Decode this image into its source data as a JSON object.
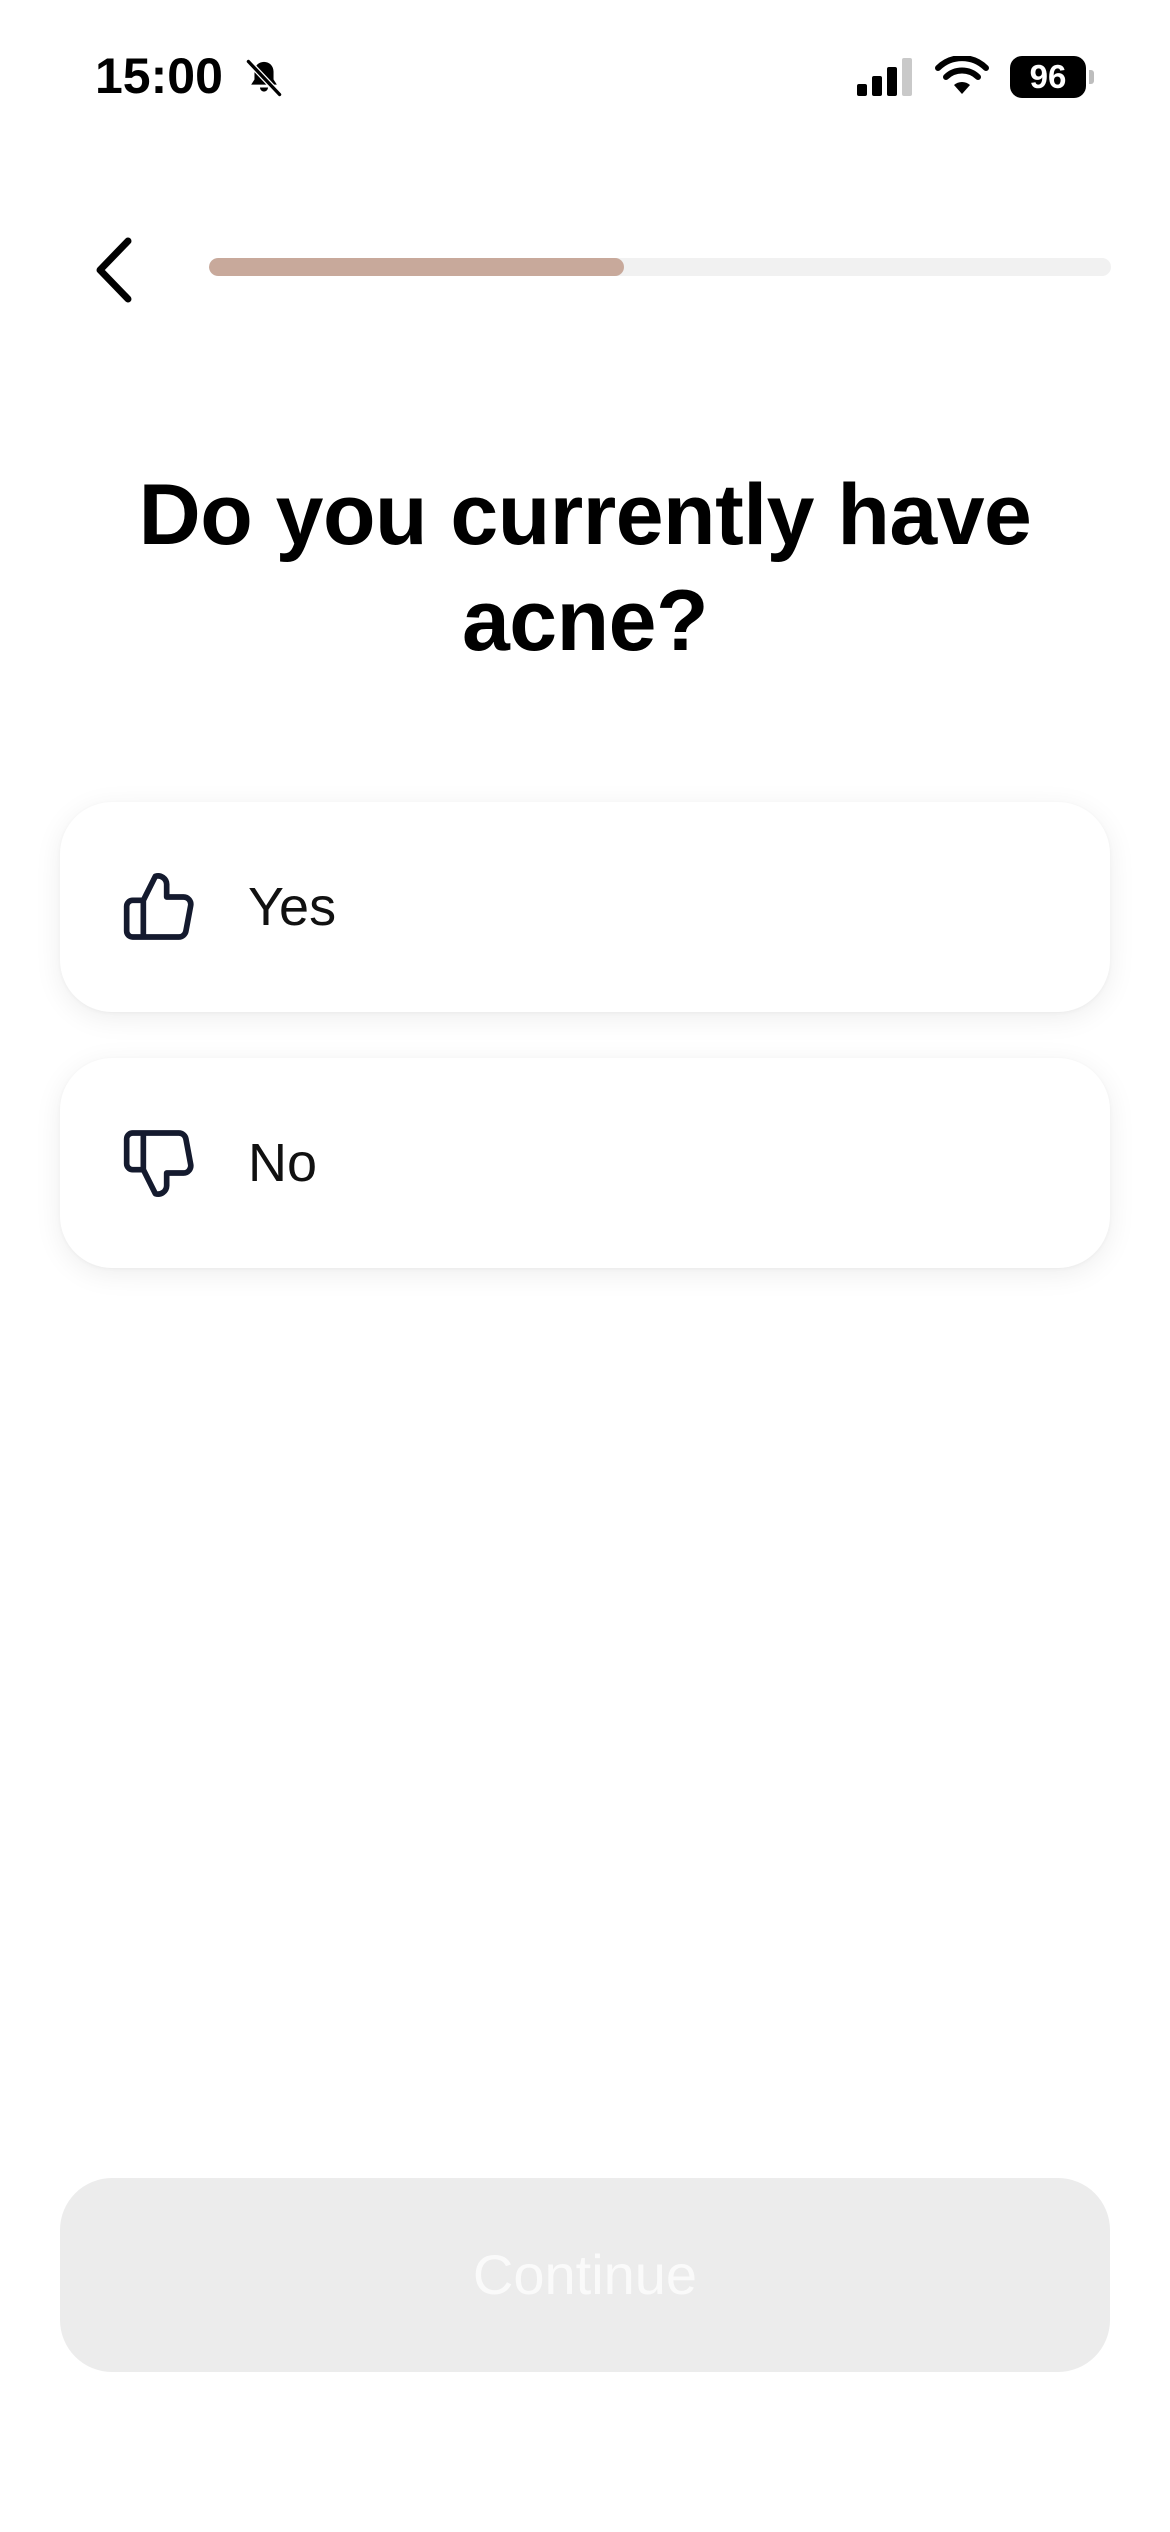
{
  "status_bar": {
    "time": "15:00",
    "battery_level": "96",
    "icons": [
      "bell-slash-icon",
      "cellular-signal-icon",
      "wifi-icon",
      "battery-icon"
    ]
  },
  "header": {
    "back_icon": "chevron-left-icon",
    "progress": 0.46
  },
  "question": {
    "title": "Do you currently have acne?"
  },
  "options": [
    {
      "label": "Yes",
      "icon": "thumbs-up-icon"
    },
    {
      "label": "No",
      "icon": "thumbs-down-icon"
    }
  ],
  "footer": {
    "continue_label": "Continue",
    "continue_enabled": false
  },
  "colors": {
    "progress_fill": "#c8a99b",
    "progress_track": "#f1f1f1",
    "button_disabled_bg": "#ececec",
    "text_primary": "#000000"
  }
}
